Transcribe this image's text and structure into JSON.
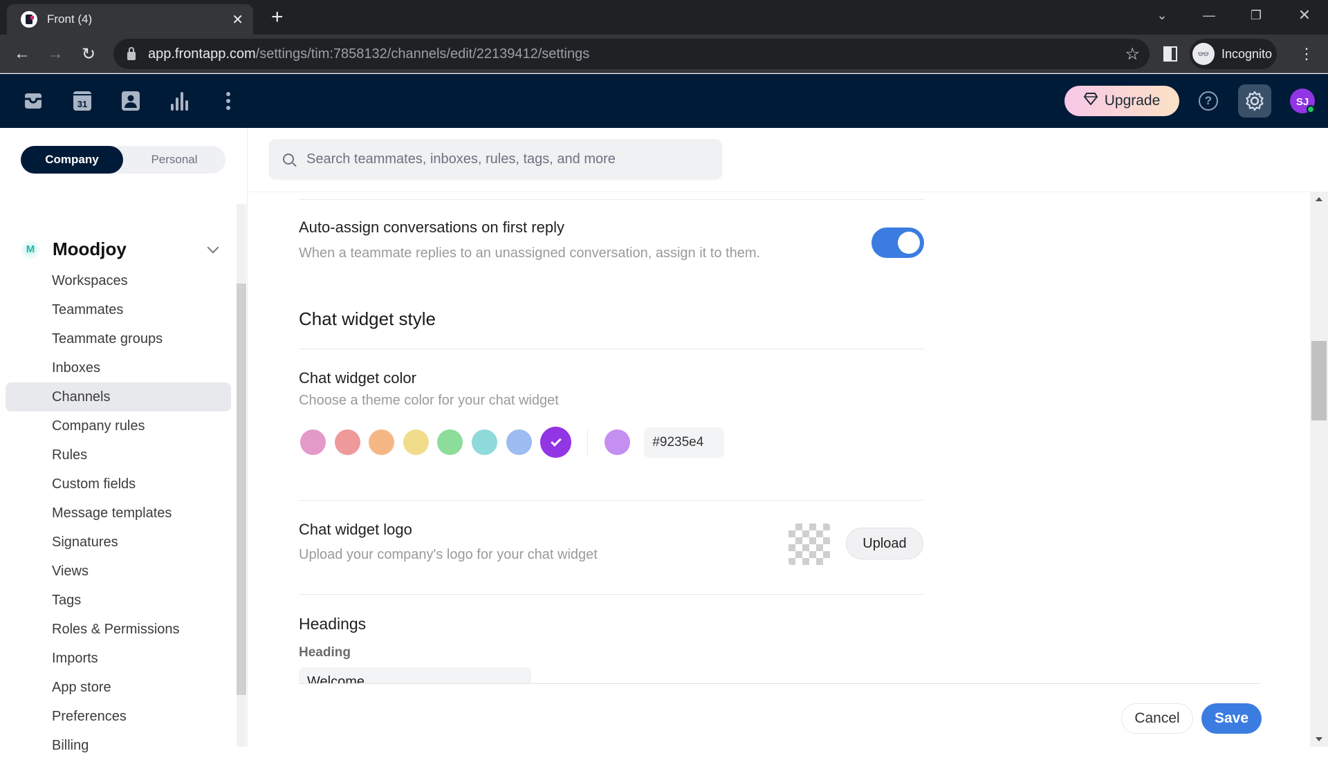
{
  "browser": {
    "tab_title": "Front (4)",
    "tab_favicon": "front-logo-icon",
    "url_domain": "app.frontapp.com",
    "url_path": "/settings/tim:7858132/channels/edit/22139412/settings",
    "incognito_label": "Incognito",
    "icons": [
      "back-icon",
      "forward-icon",
      "reload-icon",
      "lock-icon",
      "star-icon",
      "side-panel-icon",
      "incognito-icon",
      "menu-kebab-icon",
      "tab-search-icon",
      "minimize-icon",
      "restore-icon",
      "window-close-icon"
    ]
  },
  "app_header": {
    "nav_icons": [
      "inbox-icon",
      "calendar-icon",
      "contacts-icon",
      "analytics-icon",
      "more-icon"
    ],
    "calendar_day": "31",
    "upgrade_label": "Upgrade",
    "avatar_initials": "SJ",
    "avatar_color": "#9235e4",
    "status_color": "#22c55e"
  },
  "sidebar": {
    "tabs": [
      {
        "label": "Company",
        "active": true
      },
      {
        "label": "Personal",
        "active": false
      }
    ],
    "org_badge": "M",
    "org_name": "Moodjoy",
    "items": [
      {
        "label": "Workspaces"
      },
      {
        "label": "Teammates"
      },
      {
        "label": "Teammate groups"
      },
      {
        "label": "Inboxes"
      },
      {
        "label": "Channels",
        "active": true
      },
      {
        "label": "Company rules"
      },
      {
        "label": "Rules"
      },
      {
        "label": "Custom fields"
      },
      {
        "label": "Message templates"
      },
      {
        "label": "Signatures"
      },
      {
        "label": "Views"
      },
      {
        "label": "Tags"
      },
      {
        "label": "Roles & Permissions"
      },
      {
        "label": "Imports"
      },
      {
        "label": "App store"
      },
      {
        "label": "Preferences"
      },
      {
        "label": "Billing"
      }
    ]
  },
  "main": {
    "search_placeholder": "Search teammates, inboxes, rules, tags, and more",
    "auto_assign": {
      "title": "Auto-assign conversations on first reply",
      "description": "When a teammate replies to an unassigned conversation, assign it to them.",
      "enabled": true
    },
    "style_section_title": "Chat widget style",
    "color": {
      "title": "Chat widget color",
      "description": "Choose a theme color for your chat widget",
      "swatches": [
        "#e39ac9",
        "#ee9a9a",
        "#f5b885",
        "#f1dc8c",
        "#8ddd9a",
        "#8fdadb",
        "#9dbcf1",
        "#9235e4"
      ],
      "selected_index": 7,
      "custom_swatch": "#c48ff0",
      "hex_value": "#9235e4"
    },
    "logo": {
      "title": "Chat widget logo",
      "description": "Upload your company's logo for your chat widget",
      "upload_label": "Upload"
    },
    "headings": {
      "title": "Headings",
      "field_label": "Heading",
      "field_value": "Welcome"
    },
    "footer": {
      "cancel_label": "Cancel",
      "save_label": "Save"
    },
    "accent_color": "#3b7ce0"
  }
}
